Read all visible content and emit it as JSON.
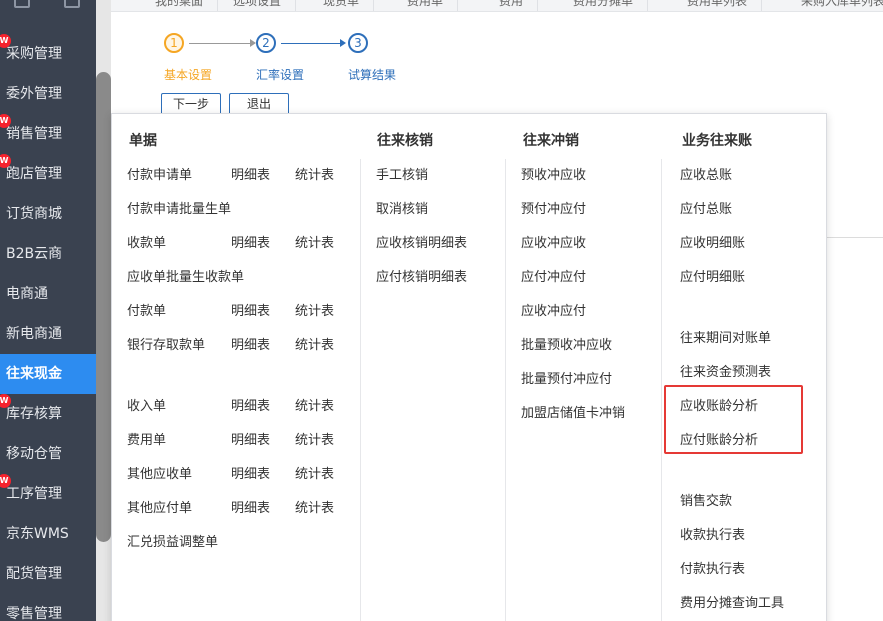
{
  "sidebar": {
    "items": [
      {
        "label": "采购管理",
        "new": true
      },
      {
        "label": "委外管理",
        "new": false
      },
      {
        "label": "销售管理",
        "new": true
      },
      {
        "label": "跑店管理",
        "new": true
      },
      {
        "label": "订货商城",
        "new": false
      },
      {
        "label": "B2B云商",
        "new": false
      },
      {
        "label": "电商通",
        "new": false
      },
      {
        "label": "新电商通",
        "new": false
      },
      {
        "label": "往来现金",
        "new": false,
        "active": true
      },
      {
        "label": "库存核算",
        "new": true
      },
      {
        "label": "移动仓管",
        "new": false
      },
      {
        "label": "工序管理",
        "new": true
      },
      {
        "label": "京东WMS",
        "new": false
      },
      {
        "label": "配货管理",
        "new": false
      },
      {
        "label": "零售管理",
        "new": false
      }
    ],
    "new_badge": "W"
  },
  "tabs": [
    "我的桌面",
    "选项设置",
    "现货单",
    "费用单",
    "费用",
    "费用分摊单",
    "费用单列表",
    "采购入库单列表"
  ],
  "stepper": {
    "steps": [
      {
        "num": "1",
        "label": "基本设置"
      },
      {
        "num": "2",
        "label": "汇率设置"
      },
      {
        "num": "3",
        "label": "试算结果"
      }
    ],
    "next_label": "下一步",
    "exit_label": "退出"
  },
  "menu": {
    "col1": {
      "header": "单据",
      "rows": [
        [
          "付款申请单",
          "明细表",
          "统计表"
        ],
        [
          "付款申请批量生单"
        ],
        [
          "收款单",
          "明细表",
          "统计表"
        ],
        [
          "应收单批量生收款单"
        ],
        [
          "付款单",
          "明细表",
          "统计表"
        ],
        [
          "银行存取款单",
          "明细表",
          "统计表"
        ],
        [
          "收入单",
          "明细表",
          "统计表"
        ],
        [
          "费用单",
          "明细表",
          "统计表"
        ],
        [
          "其他应收单",
          "明细表",
          "统计表"
        ],
        [
          "其他应付单",
          "明细表",
          "统计表"
        ],
        [
          "汇兑损益调整单"
        ]
      ]
    },
    "col2": {
      "header": "往来核销",
      "items": [
        "手工核销",
        "取消核销",
        "应收核销明细表",
        "应付核销明细表"
      ]
    },
    "col3": {
      "header": "往来冲销",
      "items": [
        "预收冲应收",
        "预付冲应付",
        "应收冲应收",
        "应付冲应付",
        "应收冲应付",
        "批量预收冲应收",
        "批量预付冲应付",
        "加盟店储值卡冲销"
      ]
    },
    "col4": {
      "header": "业务往来账",
      "items": [
        "应收总账",
        "应付总账",
        "应收明细账",
        "应付明细账",
        "往来期间对账单",
        "往来资金预测表",
        "应收账龄分析",
        "应付账龄分析",
        "销售交款",
        "收款执行表",
        "付款执行表",
        "费用分摊查询工具"
      ]
    }
  },
  "colors": {
    "sidebar_bg": "#3a4250",
    "active_item": "#2d8cf0",
    "step_active": "#f5a623",
    "step_inactive": "#2e6fba",
    "highlight": "#e53935"
  }
}
